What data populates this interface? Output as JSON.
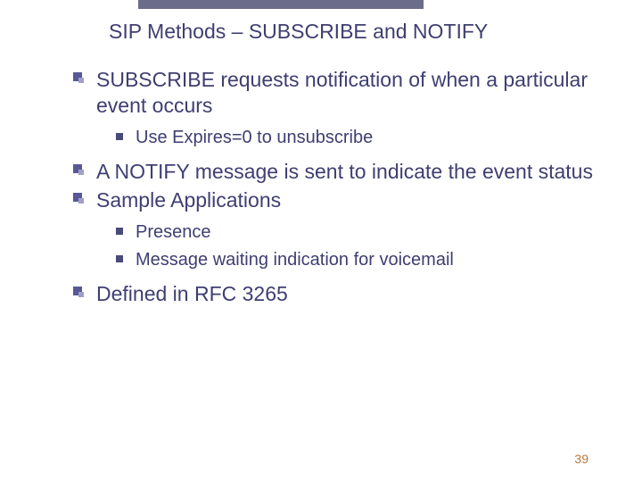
{
  "title": "SIP Methods – SUBSCRIBE and NOTIFY",
  "items": [
    {
      "text": "SUBSCRIBE requests notification of when a particular event occurs",
      "subs": [
        {
          "text": "Use Expires=0 to unsubscribe"
        }
      ]
    },
    {
      "text": "A NOTIFY message is sent to indicate the event status",
      "subs": []
    },
    {
      "text": "Sample Applications",
      "subs": [
        {
          "text": "Presence"
        },
        {
          "text": "Message waiting indication for voicemail"
        }
      ]
    },
    {
      "text": "Defined in RFC 3265",
      "subs": []
    }
  ],
  "page_number": "39"
}
